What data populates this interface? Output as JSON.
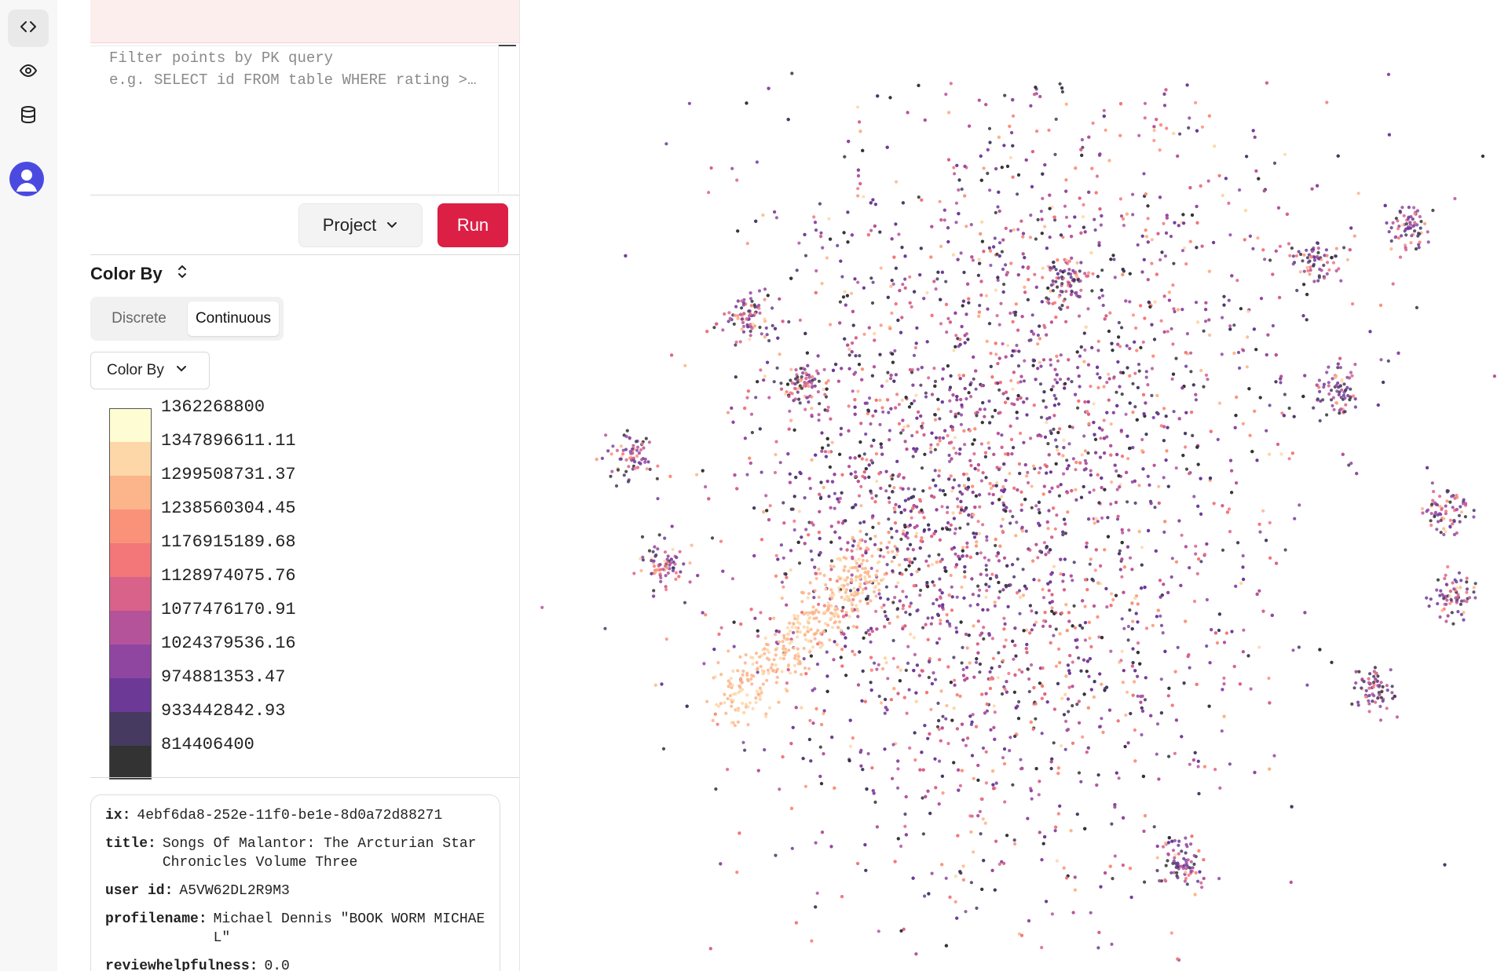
{
  "rail": {
    "items": [
      {
        "name": "code-icon",
        "active": true
      },
      {
        "name": "eye-icon",
        "active": false
      },
      {
        "name": "database-icon",
        "active": false
      }
    ]
  },
  "query": {
    "line1": "Filter points by PK query",
    "line2": "e.g. SELECT id FROM table WHERE rating >…"
  },
  "toolbar": {
    "project_label": "Project",
    "run_label": "Run"
  },
  "color_by": {
    "title": "Color By",
    "tabs": [
      "Discrete",
      "Continuous"
    ],
    "selected_tab": "Continuous",
    "select_label": "Color By"
  },
  "legend": {
    "labels": [
      "1362268800",
      "1347896611.11",
      "1299508731.37",
      "1238560304.45",
      "1176915189.68",
      "1128974075.76",
      "1077476170.91",
      "1024379536.16",
      "974881353.47",
      "933442842.93",
      "814406400"
    ],
    "colors": [
      "#fefcd2",
      "#fdd7a8",
      "#fcb48a",
      "#f99279",
      "#f37679",
      "#d9628a",
      "#b5539a",
      "#8e46a0",
      "#6c3a96",
      "#463a60",
      "#333333"
    ]
  },
  "details": {
    "fields": [
      {
        "key": "ix:",
        "value": "4ebf6da8-252e-11f0-be1e-8d0a72d88271"
      },
      {
        "key": "title:",
        "value": "Songs Of Malantor: The Arcturian Star Chronicles Volume Three"
      },
      {
        "key": "user id:",
        "value": "A5VW62DL2R9M3"
      },
      {
        "key": "profilename:",
        "value": "Michael Dennis \"BOOK WORM MICHAEL\""
      },
      {
        "key": "reviewhelpfulness:",
        "value": "0.0"
      }
    ]
  }
}
